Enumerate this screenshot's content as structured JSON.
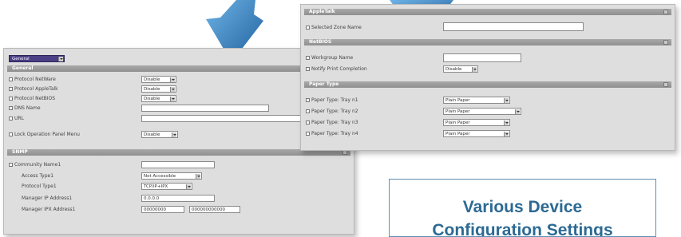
{
  "colors": {
    "arrow_blue": "#2f7fc3",
    "caption_blue": "#2c6a93",
    "panel_bg": "#dedede",
    "header_grey": "#9a9a9a",
    "mode_select_bg": "#4b3f86"
  },
  "icons": [
    "arrow-down-icon",
    "checkbox-icon",
    "dropdown-arrow-icon",
    "collapse-icon"
  ],
  "left_panel": {
    "mode_select": "General",
    "general": {
      "header": "General",
      "rows": [
        {
          "label": "Protocol NetWare",
          "value": "Disable"
        },
        {
          "label": "Protocol AppleTalk",
          "value": "Disable"
        },
        {
          "label": "Protocol NetBIOS",
          "value": "Disable"
        },
        {
          "label": "DNS Name",
          "value": ""
        },
        {
          "label": "URL",
          "value": ""
        },
        {
          "label": "Lock Operation Panel Menu",
          "value": "Disable"
        }
      ]
    },
    "snmp": {
      "header": "SNMP",
      "rows": [
        {
          "label": "Community Name1",
          "value": ""
        },
        {
          "label": "Access Type1",
          "value": "Not Accessible"
        },
        {
          "label": "Protocol Type1",
          "value": "TCP/IP+IPX"
        },
        {
          "label": "Manager IP Address1",
          "value": "0.0.0.0"
        },
        {
          "label": "Manager IPX Address1",
          "value": "00000000",
          "value2": "000000000000"
        }
      ]
    }
  },
  "right_panel": {
    "appletalk": {
      "header": "AppleTalk",
      "rows": [
        {
          "label": "Selected Zone Name",
          "value": ""
        }
      ]
    },
    "netbios": {
      "header": "NetBIOS",
      "rows": [
        {
          "label": "Workgroup Name",
          "value": ""
        },
        {
          "label": "Notify Print Completion",
          "value": "Disable"
        }
      ]
    },
    "paper_type": {
      "header": "Paper Type",
      "rows": [
        {
          "label": "Paper Type: Tray n1",
          "value": "Plain Paper"
        },
        {
          "label": "Paper Type: Tray n2",
          "value": "Plain Paper"
        },
        {
          "label": "Paper Type: Tray n3",
          "value": "Plain Paper"
        },
        {
          "label": "Paper Type: Tray n4",
          "value": "Plain Paper"
        }
      ]
    }
  },
  "caption": {
    "line1": "Various Device",
    "line2": "Configuration Settings"
  }
}
